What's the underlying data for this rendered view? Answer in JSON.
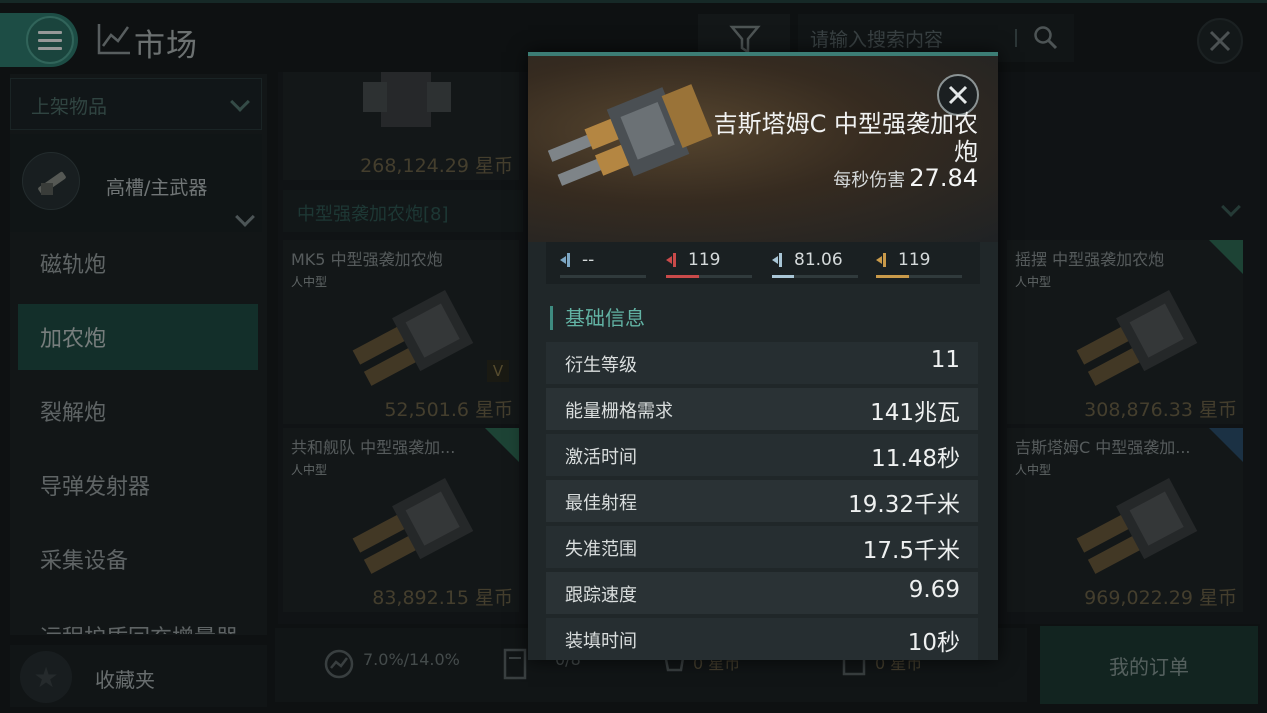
{
  "header": {
    "title": "市场",
    "search_placeholder": "请输入搜索内容"
  },
  "sidebar": {
    "dropdown_label": "上架物品",
    "category_label": "高槽/主武器",
    "items": [
      {
        "label": "磁轨炮",
        "active": false
      },
      {
        "label": "加农炮",
        "active": true
      },
      {
        "label": "裂解炮",
        "active": false
      },
      {
        "label": "导弹发射器",
        "active": false
      },
      {
        "label": "采集设备",
        "active": false
      },
      {
        "label": "远程护盾回充增量器",
        "active": false
      }
    ],
    "favorites_label": "收藏夹"
  },
  "listing": {
    "section_header": "中型强袭加农炮[8]",
    "cards": [
      {
        "name": "",
        "size": "",
        "price": "268,124.29 星币"
      },
      {
        "name": "MK5 中型强袭加农炮",
        "size": "人中型",
        "price": "52,501.6 星币",
        "badge": "V"
      },
      {
        "name": "共和舰队 中型强袭加...",
        "size": "人中型",
        "price": "83,892.15 星币"
      },
      {
        "name": "摇摆 中型强袭加农炮",
        "size": "人中型",
        "price": "308,876.33 星币"
      },
      {
        "name": "吉斯塔姆C 中型强袭加...",
        "size": "人中型",
        "price": "969,022.29 星币"
      }
    ]
  },
  "bottom_bar": {
    "tax": "7.0%/14.0%",
    "orders": "0/8",
    "buy_total": "0 星币",
    "sell_total": "0 星币",
    "my_orders_label": "我的订单"
  },
  "modal": {
    "title": "吉斯塔姆C 中型强袭加农炮",
    "dps_label": "每秒伤害",
    "dps_value": "27.84",
    "damage": [
      {
        "type": "electromagnetic",
        "value": "--",
        "fill": 0,
        "color": "#7da7c4"
      },
      {
        "type": "thermal",
        "value": "119",
        "fill": 0.38,
        "color": "#c94a4a"
      },
      {
        "type": "kinetic",
        "value": "81.06",
        "fill": 0.26,
        "color": "#a9c6d6"
      },
      {
        "type": "explosive",
        "value": "119",
        "fill": 0.38,
        "color": "#c99a4a"
      }
    ],
    "section_title": "基础信息",
    "stats": [
      {
        "key": "衍生等级",
        "value": "11"
      },
      {
        "key": "能量栅格需求",
        "value": "141兆瓦"
      },
      {
        "key": "激活时间",
        "value": "11.48秒"
      },
      {
        "key": "最佳射程",
        "value": "19.32千米"
      },
      {
        "key": "失准范围",
        "value": "17.5千米"
      },
      {
        "key": "跟踪速度",
        "value": "9.69"
      },
      {
        "key": "装填时间",
        "value": "10秒"
      }
    ]
  },
  "colors": {
    "accent": "#3e8b80",
    "price_gold": "#6e6449"
  }
}
